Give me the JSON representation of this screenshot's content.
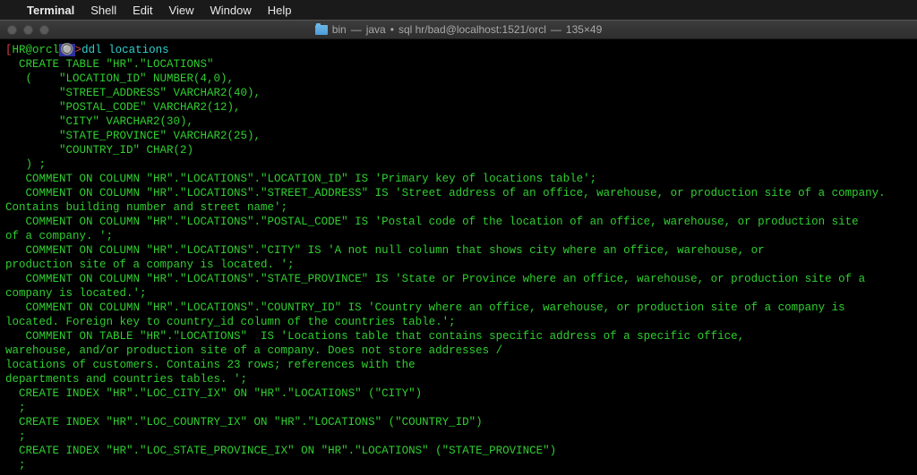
{
  "menubar": {
    "apple": "",
    "items": [
      "Terminal",
      "Shell",
      "Edit",
      "View",
      "Window",
      "Help"
    ]
  },
  "titlebar": {
    "folder": "bin",
    "separator1": " — ",
    "proc": "java",
    "separator2": " • ",
    "dbinfo": "sql hr/bad@localhost:1521/orcl",
    "separator3": " — ",
    "dims": "135×49"
  },
  "prompt": {
    "bracket_open": "[",
    "user": "HR",
    "at": "@",
    "host": "orcl",
    "extra": "🔘",
    "close": ">",
    "command": "ddl locations"
  },
  "output": [
    "  CREATE TABLE \"HR\".\"LOCATIONS\"",
    "   (    \"LOCATION_ID\" NUMBER(4,0),",
    "        \"STREET_ADDRESS\" VARCHAR2(40),",
    "        \"POSTAL_CODE\" VARCHAR2(12),",
    "        \"CITY\" VARCHAR2(30),",
    "        \"STATE_PROVINCE\" VARCHAR2(25),",
    "        \"COUNTRY_ID\" CHAR(2)",
    "   ) ;",
    "   COMMENT ON COLUMN \"HR\".\"LOCATIONS\".\"LOCATION_ID\" IS 'Primary key of locations table';",
    "   COMMENT ON COLUMN \"HR\".\"LOCATIONS\".\"STREET_ADDRESS\" IS 'Street address of an office, warehouse, or production site of a company.",
    "Contains building number and street name';",
    "   COMMENT ON COLUMN \"HR\".\"LOCATIONS\".\"POSTAL_CODE\" IS 'Postal code of the location of an office, warehouse, or production site",
    "of a company. ';",
    "   COMMENT ON COLUMN \"HR\".\"LOCATIONS\".\"CITY\" IS 'A not null column that shows city where an office, warehouse, or",
    "production site of a company is located. ';",
    "   COMMENT ON COLUMN \"HR\".\"LOCATIONS\".\"STATE_PROVINCE\" IS 'State or Province where an office, warehouse, or production site of a",
    "company is located.';",
    "   COMMENT ON COLUMN \"HR\".\"LOCATIONS\".\"COUNTRY_ID\" IS 'Country where an office, warehouse, or production site of a company is",
    "located. Foreign key to country_id column of the countries table.';",
    "   COMMENT ON TABLE \"HR\".\"LOCATIONS\"  IS 'Locations table that contains specific address of a specific office,",
    "warehouse, and/or production site of a company. Does not store addresses /",
    "locations of customers. Contains 23 rows; references with the",
    "departments and countries tables. ';",
    "  CREATE INDEX \"HR\".\"LOC_CITY_IX\" ON \"HR\".\"LOCATIONS\" (\"CITY\")",
    "  ;",
    "  CREATE INDEX \"HR\".\"LOC_COUNTRY_IX\" ON \"HR\".\"LOCATIONS\" (\"COUNTRY_ID\")",
    "  ;",
    "  CREATE INDEX \"HR\".\"LOC_STATE_PROVINCE_IX\" ON \"HR\".\"LOCATIONS\" (\"STATE_PROVINCE\")",
    "  ;"
  ]
}
